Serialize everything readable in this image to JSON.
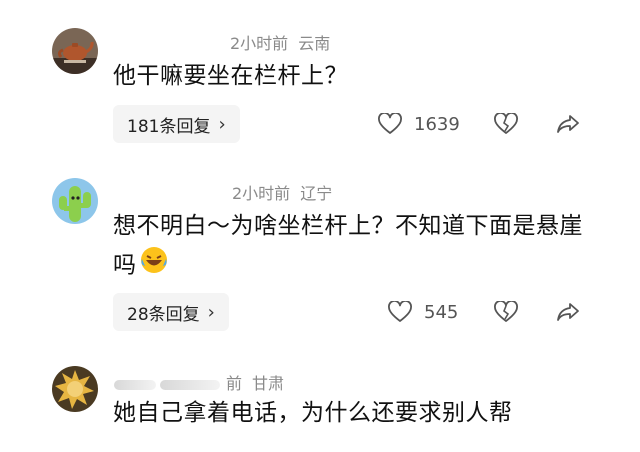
{
  "comments": [
    {
      "time": "2小时前",
      "location": "云南",
      "text": "他干嘛要坐在栏杆上？",
      "reply_label": "181条回复",
      "likes": "1639",
      "avatar_icon": "teapot-avatar-icon"
    },
    {
      "time": "2小时前",
      "location": "辽宁",
      "text": "想不明白～为啥坐栏杆上？不知道下面是悬崖吗",
      "reply_label": "28条回复",
      "likes": "545",
      "avatar_icon": "cactus-avatar-icon",
      "emoji_icon": "laughing-crying-emoji-icon"
    },
    {
      "time": "前",
      "location": "甘肃",
      "text": "她自己拿着电话，为什么还要求别人帮",
      "avatar_icon": "sun-avatar-icon"
    }
  ],
  "icons": {
    "like": "heart-outline-icon",
    "dislike": "broken-heart-icon",
    "share": "share-arrow-icon",
    "reply_chevron": "chevron-right-icon"
  },
  "colors": {
    "meta_text": "#8a8a8a",
    "reply_bg": "#f4f4f4",
    "icon": "#555555"
  }
}
